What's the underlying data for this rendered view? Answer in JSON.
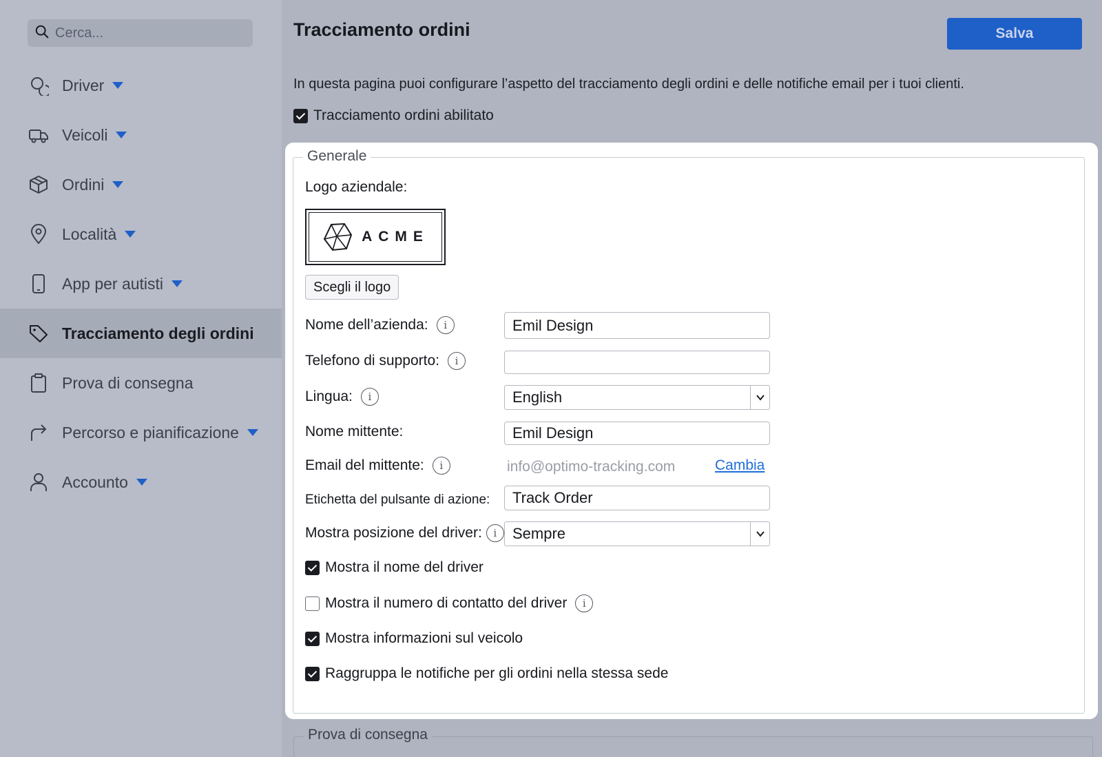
{
  "search": {
    "placeholder": "Cerca..."
  },
  "sidebar": {
    "items": [
      {
        "label": "Driver",
        "icon": "drivers-icon",
        "has_caret": true
      },
      {
        "label": "Veicoli",
        "icon": "truck-icon",
        "has_caret": true
      },
      {
        "label": "Ordini",
        "icon": "box-icon",
        "has_caret": true
      },
      {
        "label": "Località",
        "icon": "location-pin-icon",
        "has_caret": true
      },
      {
        "label": "App per autisti",
        "icon": "mobile-icon",
        "has_caret": true
      },
      {
        "label": "Tracciamento degli ordini",
        "icon": "tag-icon",
        "has_caret": false,
        "active": true
      },
      {
        "label": "Prova di consegna",
        "icon": "clipboard-icon",
        "has_caret": false
      },
      {
        "label": "Percorso e pianificazione",
        "icon": "route-arrow-icon",
        "has_caret": true
      },
      {
        "label": "Accounto",
        "icon": "user-icon",
        "has_caret": true
      }
    ]
  },
  "header": {
    "title": "Tracciamento ordini",
    "save_label": "Salva"
  },
  "intro_text": "In questa pagina puoi configurare l’aspetto del tracciamento degli ordini e delle notifiche email per i tuoi clienti.",
  "tracking_enabled": {
    "label": "Tracciamento ordini abilitato",
    "checked": true
  },
  "general": {
    "legend": "Generale",
    "logo_label": "Logo aziendale:",
    "logo_text": "ACME",
    "choose_logo_label": "Scegli il logo",
    "company_name": {
      "label": "Nome dell’azienda:",
      "value": "Emil Design"
    },
    "support_phone": {
      "label": "Telefono di supporto:",
      "value": ""
    },
    "language": {
      "label": "Lingua:",
      "value": "English"
    },
    "sender_name": {
      "label": "Nome mittente:",
      "value": "Emil Design"
    },
    "sender_email": {
      "label": "Email del mittente:",
      "value": "info@optimo-tracking.com",
      "change_label": "Cambia"
    },
    "action_button_label": {
      "label": "Etichetta del pulsante di azione:",
      "value": "Track Order"
    },
    "driver_position": {
      "label": "Mostra posizione del driver:",
      "value": "Sempre"
    },
    "checkboxes": [
      {
        "label": "Mostra il nome del driver",
        "checked": true,
        "info": false
      },
      {
        "label": "Mostra il numero di contatto del driver",
        "checked": false,
        "info": true
      },
      {
        "label": "Mostra informazioni sul veicolo",
        "checked": true,
        "info": false
      },
      {
        "label": "Raggruppa le notifiche per gli ordini nella stessa sede",
        "checked": true,
        "info": false
      }
    ]
  },
  "proof_section": {
    "legend": "Prova di consegna"
  },
  "colors": {
    "accent": "#1f5fc8",
    "link": "#1f6fd8",
    "overlay": "#afb4c0"
  }
}
